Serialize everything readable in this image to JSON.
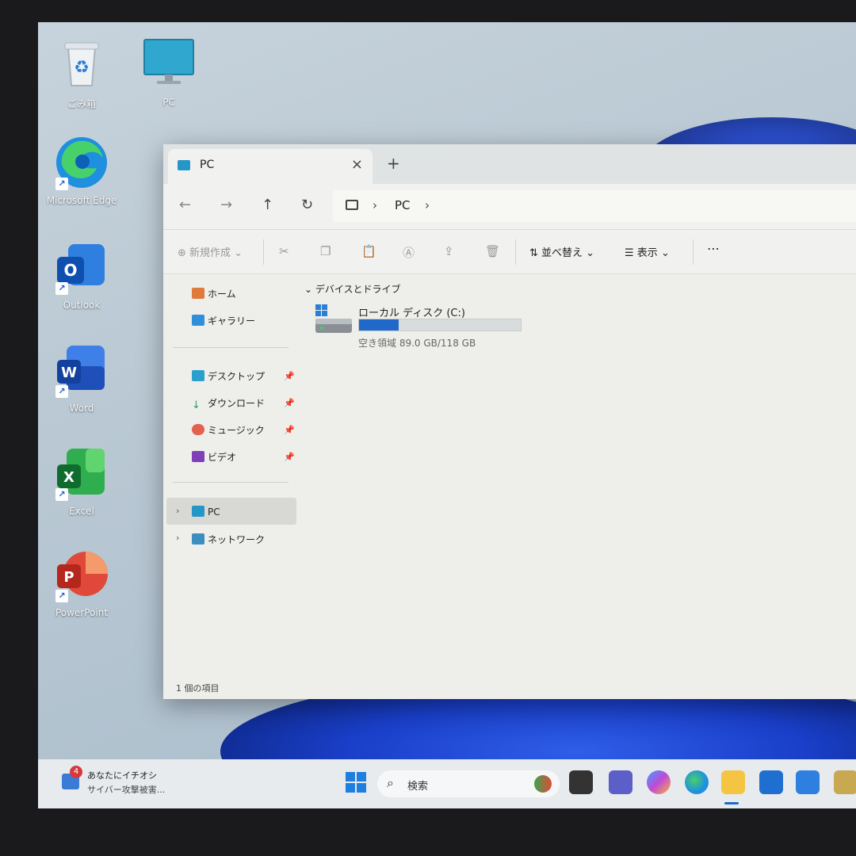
{
  "desktop": {
    "icons": [
      {
        "label": "ごみ箱"
      },
      {
        "label": "PC"
      },
      {
        "label": "Microsoft Edge"
      },
      {
        "label": "Outlook"
      },
      {
        "label": "Word"
      },
      {
        "label": "Excel"
      },
      {
        "label": "PowerPoint"
      }
    ]
  },
  "window": {
    "tab_title": "PC",
    "tab_close": "×",
    "new_tab": "+",
    "nav": {
      "back": "←",
      "forward": "→",
      "up": "↑",
      "refresh": "↻"
    },
    "address": {
      "sep1": "›",
      "crumb": "PC",
      "sep2": "›"
    },
    "toolbar": {
      "new_label": "新規作成",
      "sort_label": "並べ替え",
      "view_label": "表示",
      "more_label": "⋯"
    },
    "sidebar": {
      "home": "ホーム",
      "gallery": "ギャラリー",
      "desktop": "デスクトップ",
      "downloads": "ダウンロード",
      "music": "ミュージック",
      "videos": "ビデオ",
      "pc": "PC",
      "network": "ネットワーク"
    },
    "content": {
      "group_header": "デバイスとドライブ",
      "drive_name": "ローカル ディスク (C:)",
      "drive_free_text": "空き領域 89.0 GB/118 GB",
      "drive_used_fraction": 0.246
    },
    "status": "1 個の項目"
  },
  "taskbar": {
    "news_badge": "4",
    "news_line1": "あなたにイチオシ",
    "news_line2": "サイバー攻撃被害...",
    "search_icon": "search-icon",
    "search_label": "検索"
  }
}
